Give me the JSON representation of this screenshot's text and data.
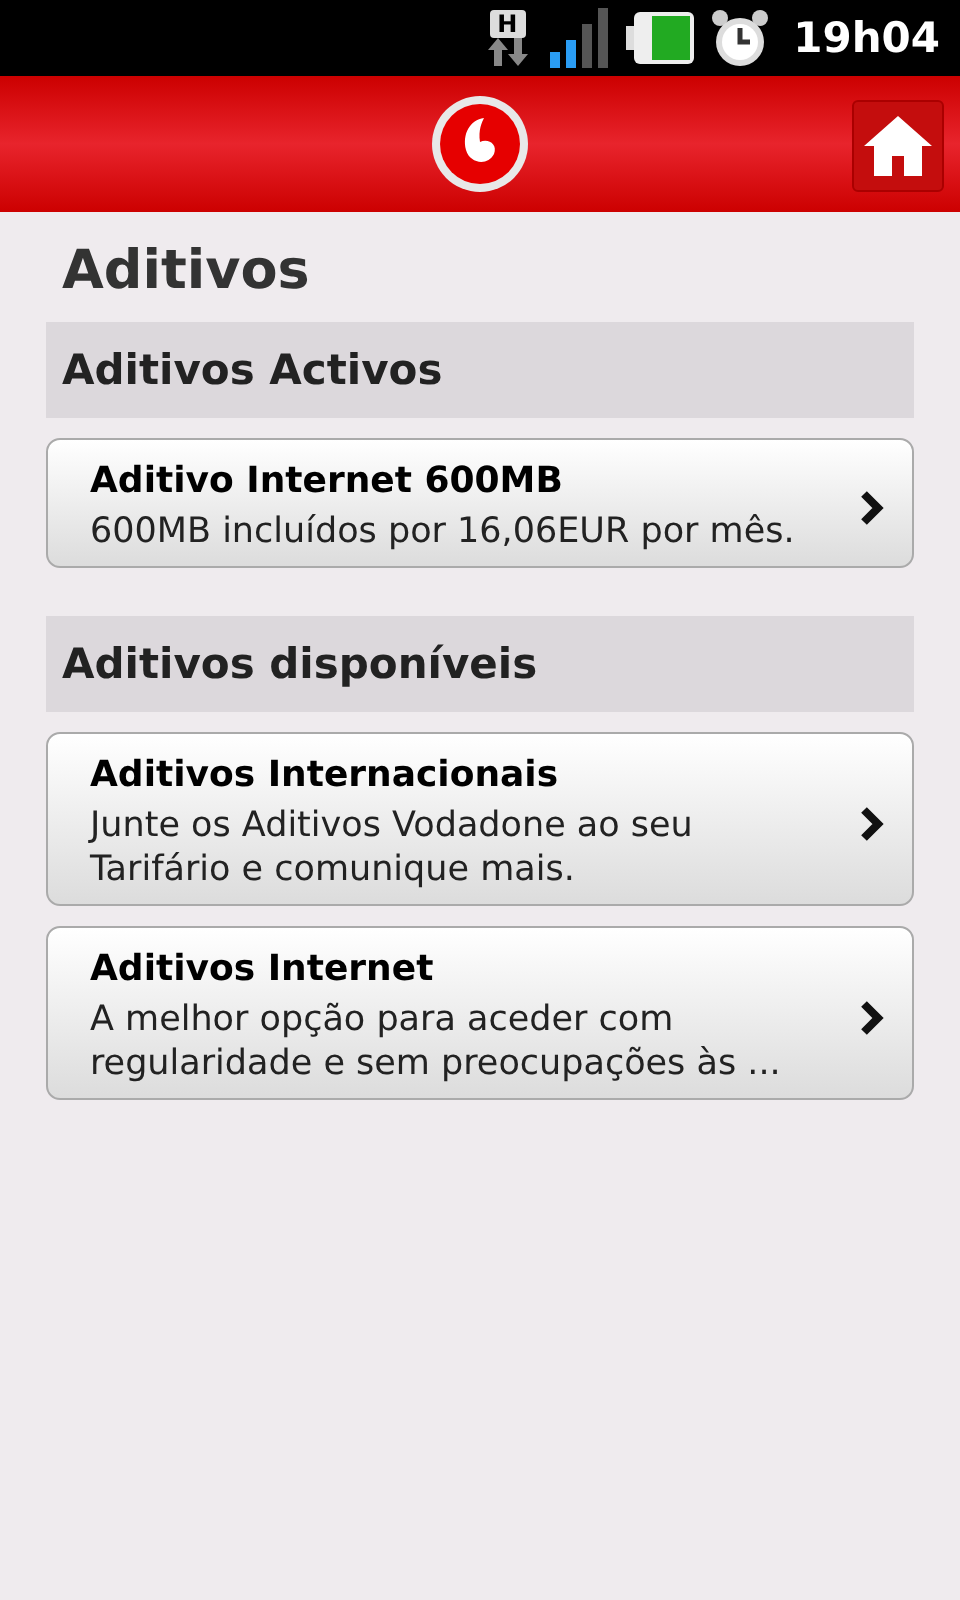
{
  "status_bar": {
    "network": "H",
    "time": "19h04"
  },
  "page_title": "Aditivos",
  "sections": [
    {
      "title": "Aditivos Activos",
      "items": [
        {
          "title": "Aditivo Internet 600MB",
          "description": "600MB incluídos por 16,06EUR por mês."
        }
      ]
    },
    {
      "title": "Aditivos disponíveis",
      "items": [
        {
          "title": "Aditivos Internacionais",
          "description": "Junte os Aditivos Vodadone ao seu Tarifário e comunique mais."
        },
        {
          "title": "Aditivos Internet",
          "description": "A melhor opção para aceder com regularidade e sem preocupações às ..."
        }
      ]
    }
  ]
}
